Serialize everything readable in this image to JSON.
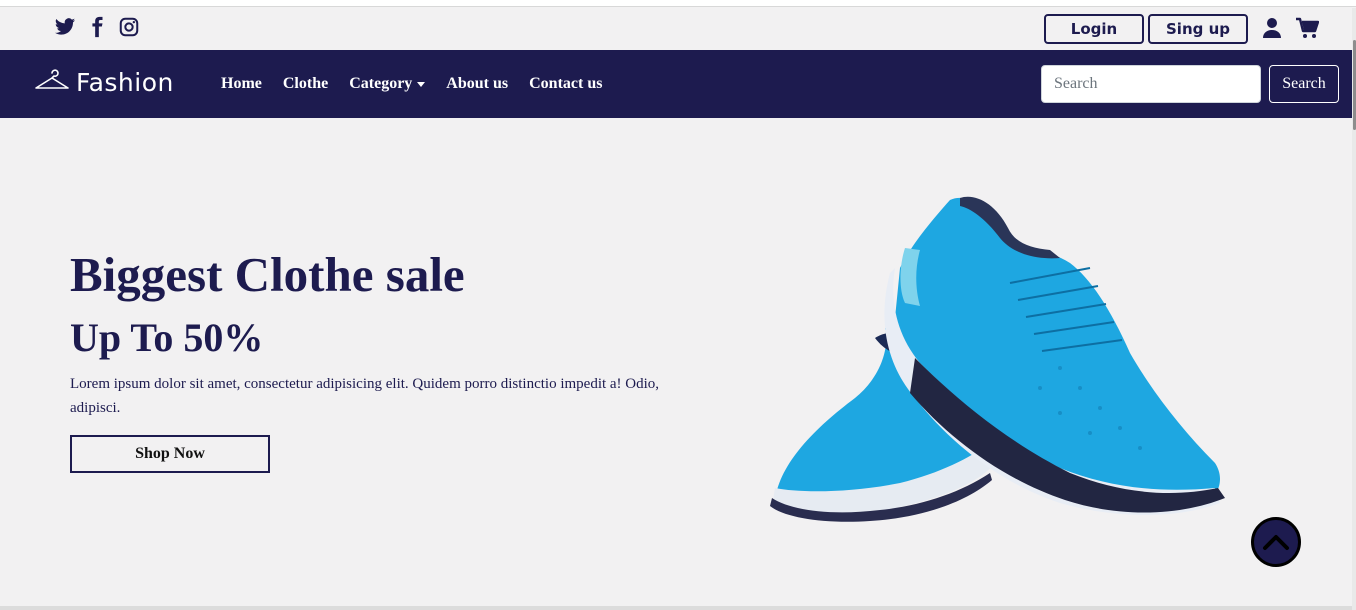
{
  "social": {
    "icons": [
      "twitter-icon",
      "facebook-icon",
      "instagram-icon"
    ]
  },
  "auth": {
    "login_label": "Login",
    "signup_label": "Sing up"
  },
  "navbar": {
    "brand": "Fashion",
    "links": [
      {
        "label": "Home"
      },
      {
        "label": "Clothe"
      },
      {
        "label": "Category"
      },
      {
        "label": "About us"
      },
      {
        "label": "Contact us"
      }
    ],
    "search_placeholder": "Search",
    "search_button": "Search"
  },
  "hero": {
    "title": "Biggest Clothe sale",
    "subtitle": "Up To 50%",
    "description": "Lorem ipsum dolor sit amet, consectetur adipisicing elit. Quidem porro distinctio impedit a! Odio, adipisci.",
    "cta": "Shop Now"
  },
  "colors": {
    "primary": "#1d1b4f",
    "background": "#f2f1f2",
    "shoe": "#1ea7e1"
  }
}
